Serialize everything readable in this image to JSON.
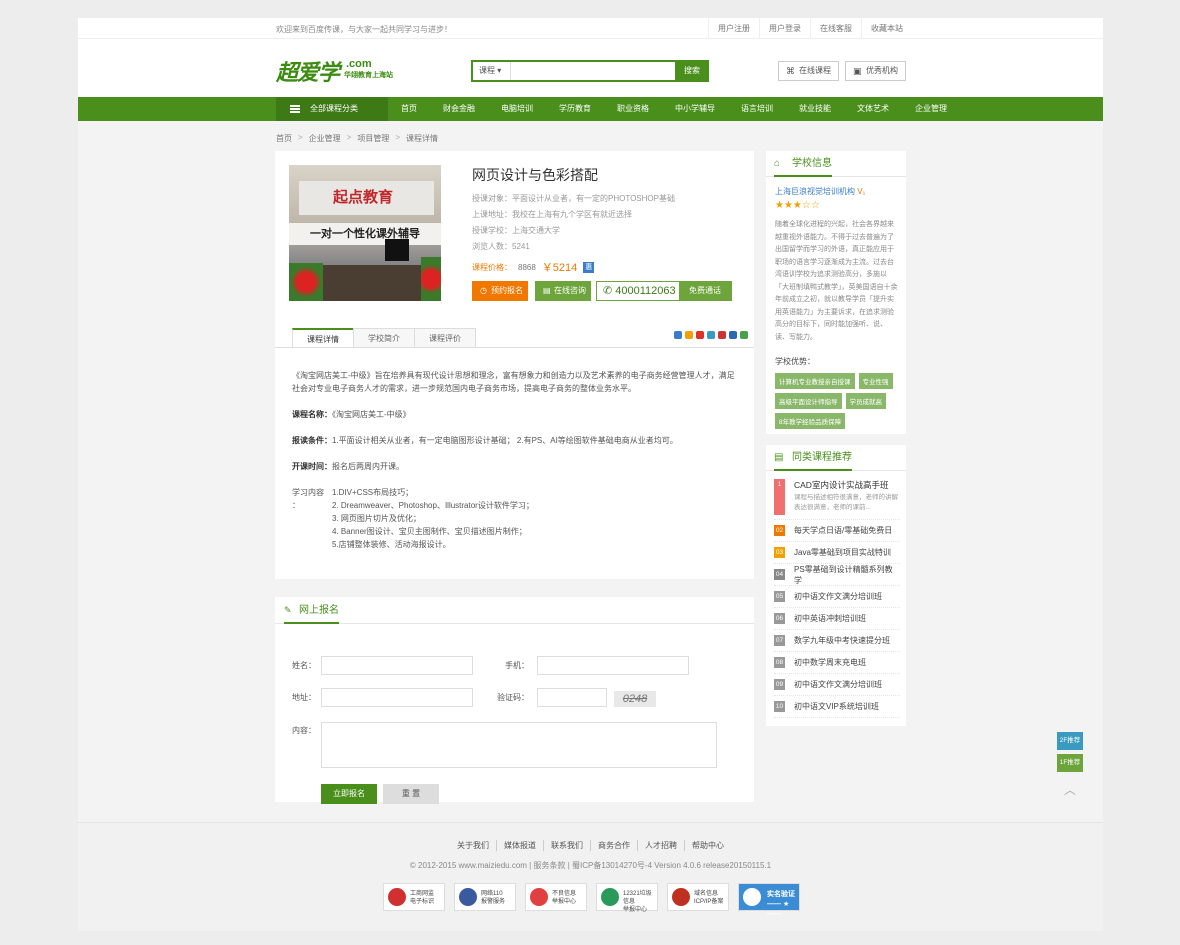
{
  "topbar": {
    "welcome": "欢迎来到百度传课，与大家一起共同学习与进步！",
    "links": [
      "用户注册",
      "用户登录",
      "在线客服",
      "收藏本站"
    ]
  },
  "header": {
    "logo": "超爱学",
    "logo_suffix": ".com",
    "logo_sub": "华翊教育上海站",
    "search_select": "课程",
    "search_placeholder": "",
    "search_button": "搜索",
    "online_course": "在线课程",
    "good_org": "优秀机构"
  },
  "nav": {
    "all": "全部课程分类",
    "items": [
      "首页",
      "财会金融",
      "电脑培训",
      "学历教育",
      "职业资格",
      "中小学辅导",
      "语言培训",
      "就业技能",
      "文体艺术",
      "企业管理"
    ]
  },
  "breadcrumb": [
    "首页",
    "企业管理",
    "项目管理",
    "课程详情"
  ],
  "course": {
    "image_text1": "起点教育",
    "image_text2": "一对一个性化课外辅导",
    "title": "网页设计与色彩搭配",
    "audience": "授课对象：平面设计从业者，有一定的PHOTOSHOP基础",
    "address": "上课地址：我校在上海有九个学区有就近选择",
    "school": "授课学校：上海交通大学",
    "views": "浏览人数：5241",
    "price_label": "课程价格：",
    "old_price": "8868",
    "new_price": "￥5214",
    "price_tag": "惠",
    "btn_signup": "预约报名",
    "btn_consult": "在线咨询",
    "phone": "4000112063",
    "btn_free_call": "免费通话"
  },
  "tabs": [
    "课程详情",
    "学校简介",
    "课程评价"
  ],
  "share_colors": [
    "#3a7cc9",
    "#f0a000",
    "#e0302a",
    "#3a9abf",
    "#cc3333",
    "#2a6ab0",
    "#4aa04a"
  ],
  "detail": {
    "intro": "《淘宝网店美工-中级》旨在培养具有现代设计思想和理念，富有想象力和创造力以及艺术素养的电子商务经营管理人才，满足社会对专业电子商务人才的需求，进一步规范国内电子商务市场，提高电子商务的整体业务水平。",
    "name_label": "课程名称：",
    "name_value": "《淘宝网店美工-中级》",
    "req_label": "报读条件：",
    "req_value": "1.平面设计相关从业者，有一定电脑图形设计基础；   2.有PS、AI等绘图软件基础电商从业者均可。",
    "time_label": "开课时间：",
    "time_value": "报名后两周内开课。",
    "study_label": "学习内容 ：",
    "study_items": [
      "1.DIV+CSS布局技巧；",
      "2. Dreamweaver、Photoshop、Illustrator设计软件学习；",
      "3. 网页图片切片及优化；",
      "4. Banner图设计、宝贝主图制作、宝贝描述图片制作；",
      "5.店铺整体装修、活动海报设计。"
    ]
  },
  "school": {
    "header": "学校信息",
    "name": "上海巨浪视觉培训机构",
    "verified": "V₁",
    "stars": "★★★☆☆",
    "desc": "随着全球化进程的兴起，社会各界越来越重视外语能力。不得于过去普遍为了出国留学而学习的外语，真正能应用于职场的语言学习逐渐成为主流。过去台湾语训学校为追求测验高分，多施以「大班制填鸭式教学」，英美国语自十余年前成立之初，就以教导学员「提升实用英语能力」为主要诉求，在追求测验高分的目标下，同时能加强听、说、读、写能力。",
    "adv_label": "学校优势：",
    "tags": [
      "计算机专业教授亲自授课",
      "专业性强",
      "高级平面设计师指导",
      "学员成就高",
      "8年教学经验品质保障"
    ]
  },
  "recommend": {
    "header": "同类课程推荐",
    "first_title": "CAD室内设计实战高手班",
    "first_desc": "课程与描述相符很满意，老师的讲解表达很满意，老师的课前...",
    "items": [
      {
        "n": "1",
        "t": "CAD室内设计实战高手班"
      },
      {
        "n": "02",
        "t": "每天学点日语/零基础免费日"
      },
      {
        "n": "03",
        "t": "Java零基础到项目实战特训"
      },
      {
        "n": "04",
        "t": "PS零基础到设计精髓系列教学"
      },
      {
        "n": "05",
        "t": "初中语文作文满分培训班"
      },
      {
        "n": "06",
        "t": "初中英语冲刺培训班"
      },
      {
        "n": "07",
        "t": "数学九年级中考快速提分班"
      },
      {
        "n": "08",
        "t": "初中数学周末充电班"
      },
      {
        "n": "09",
        "t": "初中语文作文满分培训班"
      },
      {
        "n": "10",
        "t": "初中语文VIP系统培训班"
      }
    ],
    "item_colors": [
      "#f07070",
      "#f07800",
      "#f0a000",
      "#888",
      "#999",
      "#999",
      "#999",
      "#999",
      "#999",
      "#999"
    ]
  },
  "form": {
    "header": "网上报名",
    "name_label": "姓名：",
    "phone_label": "手机：",
    "address_label": "地址：",
    "captcha_label": "验证码：",
    "captcha": "0248",
    "content_label": "内容：",
    "submit": "立即报名",
    "reset": "重 置"
  },
  "float": {
    "btn2f": "2F推荐",
    "btn1f": "1F推荐",
    "top": "︿"
  },
  "footer": {
    "links": [
      "关于我们",
      "媒体报道",
      "联系我们",
      "商务合作",
      "人才招聘",
      "帮助中心"
    ],
    "copyright": "© 2012-2015 www.maiziedu.com | 服务条款 | 蜀ICP备13014270号-4 Version 4.0.6 release20150115.1",
    "badges": [
      {
        "l1": "工商网监",
        "l2": "电子标识"
      },
      {
        "l1": "网络110",
        "l2": "报警服务"
      },
      {
        "l1": "不良信息",
        "l2": "举报中心"
      },
      {
        "l1": "12321垃圾信息",
        "l2": "举报中心"
      },
      {
        "l1": "域名信息",
        "l2": "ICP/IP备案"
      },
      {
        "l1": "实名验证",
        "l2": "—— ★ ——"
      }
    ],
    "badge_colors": [
      "#d03030",
      "#3a5aa0",
      "#e04040",
      "#2a9a5a",
      "#c03020",
      "#3a8cd5"
    ]
  }
}
